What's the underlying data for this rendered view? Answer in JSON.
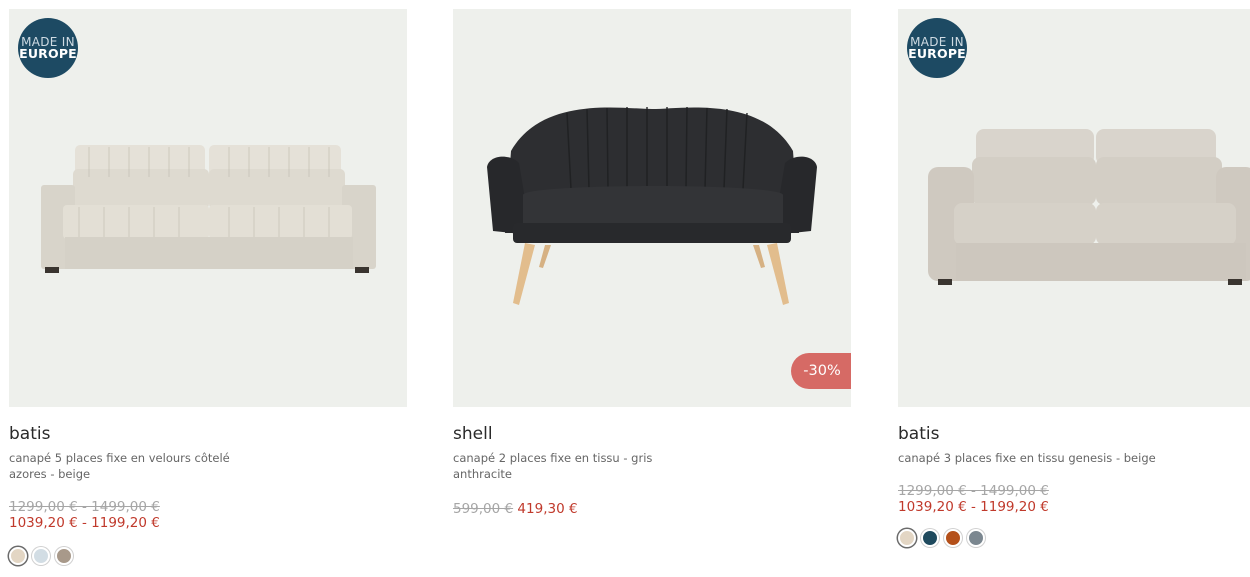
{
  "products": [
    {
      "badge": {
        "line1": "MADE IN",
        "line2": "EUROPE"
      },
      "name": "batis",
      "description": "canapé 5 places fixe en velours côtelé azores - beige",
      "old_price": "1299,00 € - 1499,00 €",
      "new_price": "1039,20 € - 1199,20 €",
      "swatches": [
        {
          "color": "#e3d6c4",
          "selected": true
        },
        {
          "color": "#d2dde4",
          "selected": false
        },
        {
          "color": "#a8998a",
          "selected": false
        }
      ]
    },
    {
      "name": "shell",
      "description": "canapé 2 places fixe en tissu - gris anthracite",
      "old_price": "599,00 €",
      "new_price": "419,30 €",
      "discount": "-30%"
    },
    {
      "badge": {
        "line1": "MADE IN",
        "line2": "EUROPE"
      },
      "name": "batis",
      "description": "canapé 3 places fixe en tissu genesis - beige",
      "old_price": "1299,00 € - 1499,00 €",
      "new_price": "1039,20 € - 1199,20 €",
      "swatches": [
        {
          "color": "#e3d6c4",
          "selected": true
        },
        {
          "color": "#1f4a5e",
          "selected": false
        },
        {
          "color": "#b4501a",
          "selected": false
        },
        {
          "color": "#7b8790",
          "selected": false
        }
      ]
    }
  ],
  "colors": {
    "badge_bg": "#1d4a63",
    "discount_bg": "#d66a65",
    "sale_price": "#c0392b",
    "image_bg": "#eef0ec"
  }
}
